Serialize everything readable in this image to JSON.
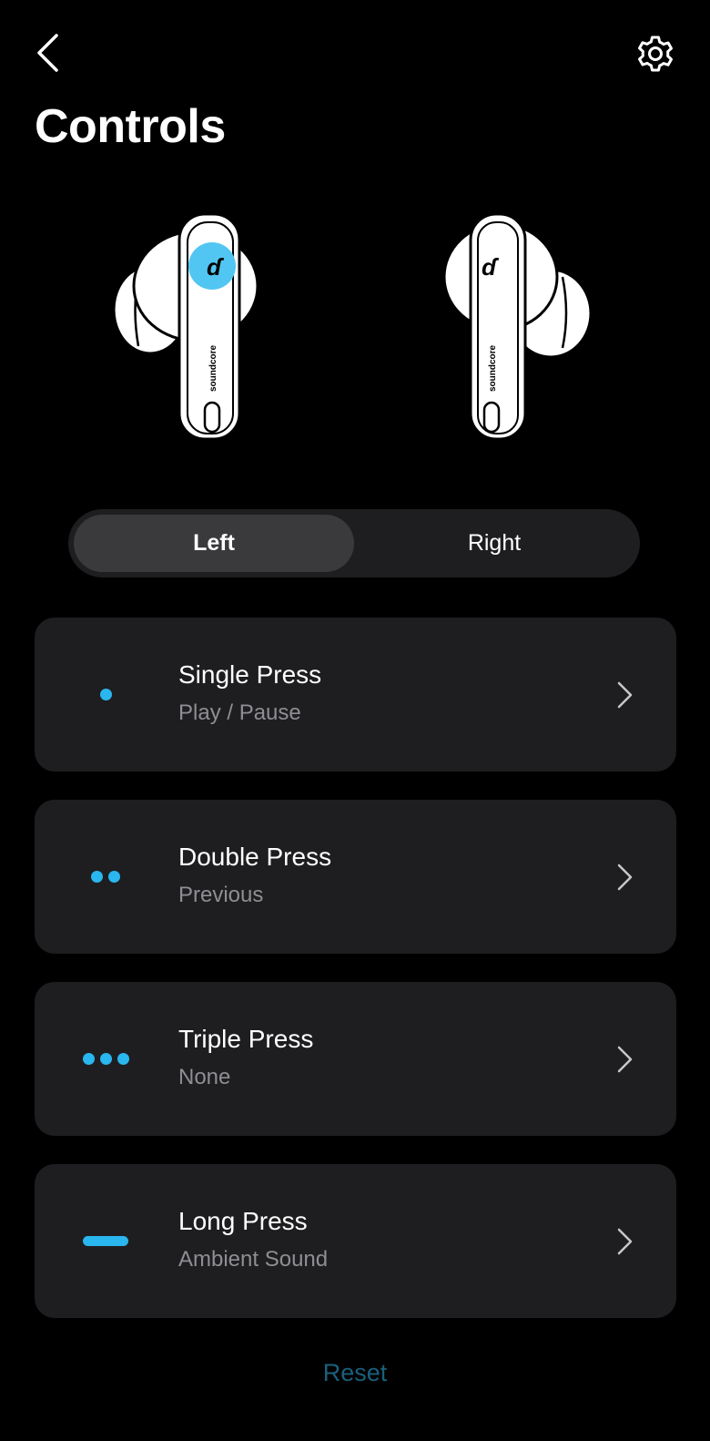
{
  "header": {
    "back_icon": "chevron-left-icon",
    "settings_icon": "gear-icon",
    "title": "Controls"
  },
  "earbuds": {
    "left_highlight_color": "#52c6f2",
    "brand_text": "soundcore"
  },
  "side_toggle": {
    "options": [
      "Left",
      "Right"
    ],
    "selected": "Left"
  },
  "controls": [
    {
      "indicator": "single-dot",
      "title": "Single Press",
      "action": "Play / Pause"
    },
    {
      "indicator": "double-dot",
      "title": "Double Press",
      "action": "Previous"
    },
    {
      "indicator": "triple-dot",
      "title": "Triple Press",
      "action": "None"
    },
    {
      "indicator": "long-dash",
      "title": "Long Press",
      "action": "Ambient Sound"
    }
  ],
  "reset_label": "Reset",
  "colors": {
    "accent": "#2ab6ee",
    "card_bg": "#1e1e20",
    "reset_text": "#1b5f7c"
  }
}
